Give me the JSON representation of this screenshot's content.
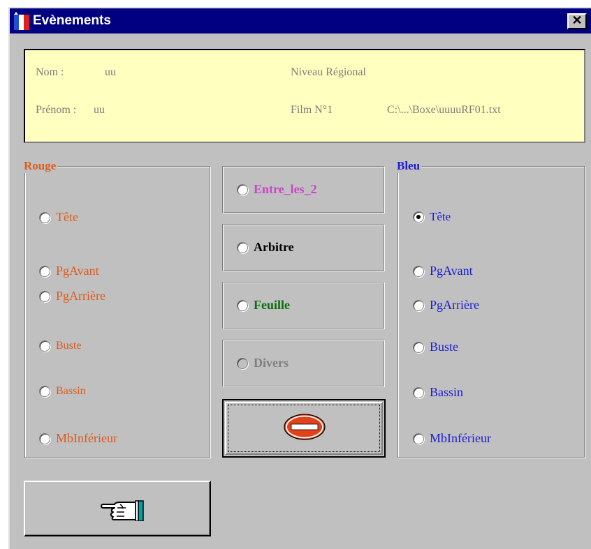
{
  "window": {
    "title": "Evènements",
    "close_label": "✕"
  },
  "info": {
    "nom_label": "Nom :",
    "nom_value": "uu",
    "prenom_label": "Prénom :",
    "prenom_value": "uu",
    "niveau": "Niveau Régional",
    "film_label": "Film N°1",
    "film_path": "C:\\...\\Boxe\\uuuuRF01.txt"
  },
  "rouge": {
    "title": "Rouge",
    "color": "#e05a1b",
    "options": [
      "Tête",
      "PgAvant",
      "PgArrière",
      "Buste",
      "Bassin",
      "MbInférieur"
    ],
    "selected": null
  },
  "bleu": {
    "title": "Bleu",
    "color": "#1c1cd6",
    "options": [
      "Tête",
      "PgAvant",
      "PgArrière",
      "Buste",
      "Bassin",
      "MbInférieur"
    ],
    "selected": "Tête"
  },
  "center": {
    "entre": {
      "label": "Entre_les_2",
      "color": "#cc44cc"
    },
    "arbitre": {
      "label": "Arbitre",
      "color": "#000000"
    },
    "feuille": {
      "label": "Feuille",
      "color": "#0a6e0a"
    },
    "divers": {
      "label": "Divers",
      "color": "#808080"
    }
  },
  "buttons": {
    "stop_icon": "no-entry-icon",
    "hand_icon": "pointing-hand-icon"
  }
}
